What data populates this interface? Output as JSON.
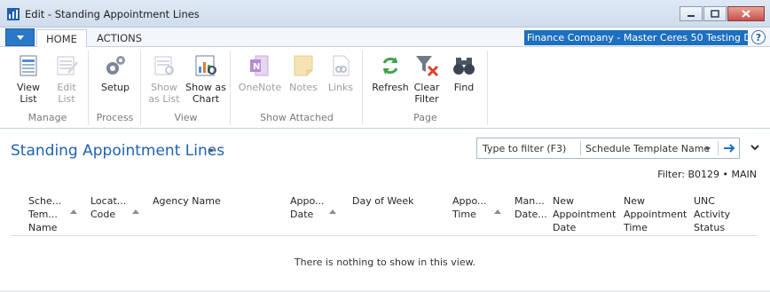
{
  "window": {
    "title": "Edit - Standing Appointment Lines"
  },
  "ribbon": {
    "tabs": [
      {
        "label": "HOME"
      },
      {
        "label": "ACTIONS"
      }
    ],
    "company": "Finance Company - Master Ceres 50 Testing Da...",
    "help_label": "?",
    "groups": {
      "manage": {
        "label": "Manage",
        "buttons": {
          "view_list": "View\nList",
          "edit_list": "Edit\nList"
        }
      },
      "process": {
        "label": "Process",
        "buttons": {
          "setup": "Setup"
        }
      },
      "view": {
        "label": "View",
        "buttons": {
          "show_as_list": "Show\nas List",
          "show_as_chart": "Show as\nChart"
        }
      },
      "show_attached": {
        "label": "Show Attached",
        "buttons": {
          "onenote": "OneNote",
          "notes": "Notes",
          "links": "Links"
        }
      },
      "page": {
        "label": "Page",
        "buttons": {
          "refresh": "Refresh",
          "clear_filter": "Clear\nFilter",
          "find": "Find"
        }
      }
    }
  },
  "page": {
    "title": "Standing Appointment Lines",
    "filter_input_placeholder": "Type to filter (F3)",
    "filter_field": "Schedule Template Name",
    "filter_summary": "Filter: B0129 • MAIN",
    "empty_message": "There is nothing to show in this view."
  },
  "columns": [
    {
      "label": "Sche...\nTem...\nName"
    },
    {
      "label": "Locat...\nCode"
    },
    {
      "label": "Agency Name"
    },
    {
      "label": "Appo...\nDate"
    },
    {
      "label": "Day of Week"
    },
    {
      "label": "Appo...\nTime"
    },
    {
      "label": "Man...\nDate..."
    },
    {
      "label": "New\nAppointment\nDate"
    },
    {
      "label": "New\nAppointment\nTime"
    },
    {
      "label": "UNC\nActivity\nStatus"
    }
  ],
  "colors": {
    "accent": "#1d6fbf",
    "title": "#1e62b0",
    "disabled": "#9e9e9e"
  }
}
